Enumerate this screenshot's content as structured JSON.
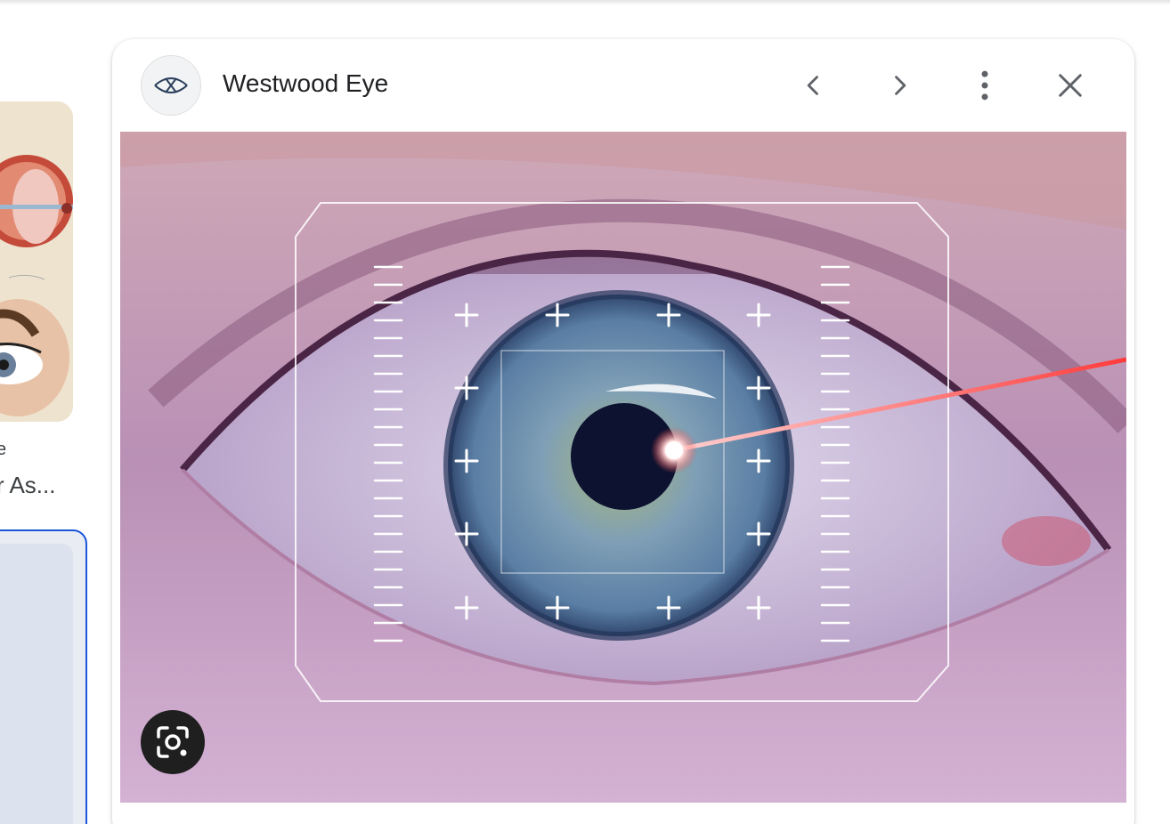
{
  "left_result": {
    "thumbnail_icon": "eye-anatomy-illustration",
    "caption_line1": "e",
    "caption_line2": "r As..."
  },
  "preview": {
    "source_name": "Westwood Eye",
    "source_icon": "westwood-eye-logo-icon",
    "buttons": {
      "previous": "chevron-left-icon",
      "next": "chevron-right-icon",
      "more": "more-vert-icon",
      "close": "close-icon",
      "lens": "google-lens-icon"
    },
    "image": {
      "subject": "eye-laser-targeting-photo",
      "colors": {
        "skin": "#c9a6c4",
        "iris": "#5f86a8",
        "laser": "#ff3b3b",
        "overlay": "#ffffff"
      }
    }
  }
}
